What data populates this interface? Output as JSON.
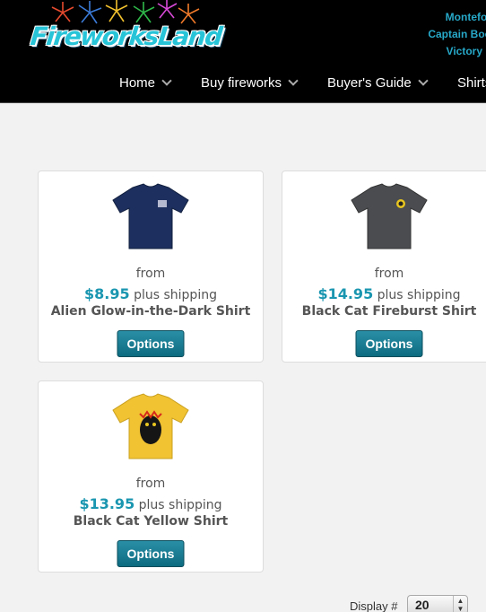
{
  "header": {
    "logo_text": "FireworksLand",
    "right_links": [
      "Montefort",
      "Captain Boo",
      "Victory"
    ],
    "nav": [
      {
        "label": "Home"
      },
      {
        "label": "Buy fireworks"
      },
      {
        "label": "Buyer's Guide"
      },
      {
        "label": "Shirts"
      }
    ]
  },
  "products": [
    {
      "from": "from",
      "price": "$8.95",
      "shipping": "plus shipping",
      "name": "Alien Glow-in-the-Dark Shirt",
      "button": "Options",
      "shirt_color": "#1d2f5e",
      "shirt_icon": "tshirt-navy-icon"
    },
    {
      "from": "from",
      "price": "$14.95",
      "shipping": "plus shipping",
      "name": "Black Cat Fireburst Shirt",
      "button": "Options",
      "shirt_color": "#4a4c50",
      "shirt_icon": "tshirt-gray-icon"
    },
    {
      "from": "from",
      "price": "$13.95",
      "shipping": "plus shipping",
      "name": "Black Cat Yellow Shirt",
      "button": "Options",
      "shirt_color": "#f1c232",
      "shirt_icon": "tshirt-yellow-icon"
    }
  ],
  "display": {
    "label": "Display #",
    "value": "20"
  },
  "colors": {
    "accent": "#1a96b0",
    "button": "#0d6b80",
    "header_bg": "#000000"
  }
}
